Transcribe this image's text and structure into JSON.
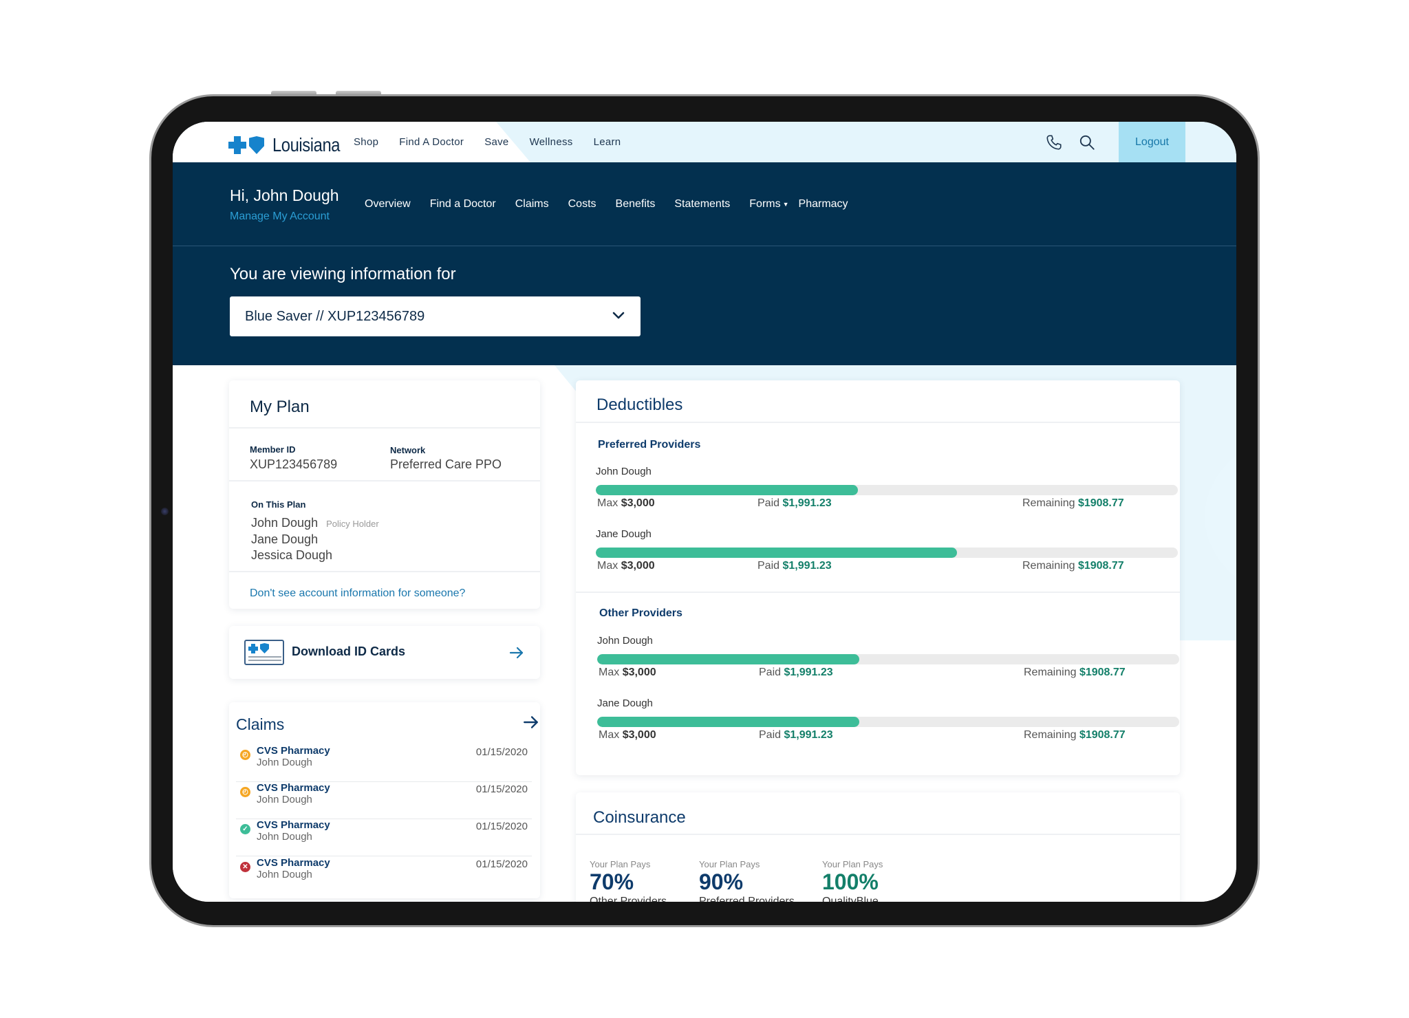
{
  "topbar": {
    "brand": "Louisiana",
    "nav": [
      "Shop",
      "Find A Doctor",
      "Save",
      "Wellness",
      "Learn"
    ],
    "icons": [
      "phone-icon",
      "search-icon"
    ],
    "logout": "Logout"
  },
  "header": {
    "greeting": "Hi, John Dough",
    "manage_account": "Manage My Account",
    "nav": [
      "Overview",
      "Find a Doctor",
      "Claims",
      "Costs",
      "Benefits",
      "Statements",
      "Forms",
      "Pharmacy"
    ],
    "viewing_label": "You are viewing information for",
    "plan_selected": "Blue Saver // XUP123456789"
  },
  "my_plan": {
    "title": "My Plan",
    "member_id_label": "Member ID",
    "member_id": "XUP123456789",
    "network_label": "Network",
    "network": "Preferred Care PPO",
    "on_plan_label": "On This Plan",
    "members": [
      {
        "name": "John Dough",
        "role": "Policy Holder"
      },
      {
        "name": "Jane Dough",
        "role": ""
      },
      {
        "name": "Jessica Dough",
        "role": ""
      }
    ],
    "missing_link": "Don't see account information for someone?"
  },
  "download": {
    "label": "Download ID Cards"
  },
  "claims": {
    "title": "Claims",
    "items": [
      {
        "provider": "CVS Pharmacy",
        "member": "John Dough",
        "date": "01/15/2020",
        "status": "pending"
      },
      {
        "provider": "CVS Pharmacy",
        "member": "John Dough",
        "date": "01/15/2020",
        "status": "pending"
      },
      {
        "provider": "CVS Pharmacy",
        "member": "John Dough",
        "date": "01/15/2020",
        "status": "approved"
      },
      {
        "provider": "CVS Pharmacy",
        "member": "John Dough",
        "date": "01/15/2020",
        "status": "denied"
      }
    ],
    "status_colors": {
      "pending": "#f5a623",
      "approved": "#3dbd98",
      "denied": "#c0313b"
    }
  },
  "deductibles": {
    "title": "Deductibles",
    "max_label": "Max",
    "paid_label": "Paid",
    "remaining_label": "Remaining",
    "groups": [
      {
        "title": "Preferred Providers",
        "people": [
          {
            "name": "John Dough",
            "max": "$3,000",
            "paid": "$1,991.23",
            "remaining": "$1908.77",
            "progress": 0.45
          },
          {
            "name": "Jane Dough",
            "max": "$3,000",
            "paid": "$1,991.23",
            "remaining": "$1908.77",
            "progress": 0.62
          }
        ]
      },
      {
        "title": "Other Providers",
        "people": [
          {
            "name": "John Dough",
            "max": "$3,000",
            "paid": "$1,991.23",
            "remaining": "$1908.77",
            "progress": 0.45
          },
          {
            "name": "Jane Dough",
            "max": "$3,000",
            "paid": "$1,991.23",
            "remaining": "$1908.77",
            "progress": 0.45
          }
        ]
      }
    ],
    "bar_color": "#3dbd98"
  },
  "coinsurance": {
    "title": "Coinsurance",
    "items": [
      {
        "label": "Your Plan Pays",
        "percent": "70%",
        "provider": "Other Providers"
      },
      {
        "label": "Your Plan Pays",
        "percent": "90%",
        "provider": "Preferred Providers"
      },
      {
        "label": "Your Plan Pays",
        "percent": "100%",
        "provider": "QualityBlue"
      }
    ]
  },
  "colors": {
    "header_bg": "#03304f",
    "accent": "#1a77ad",
    "green": "#137f69"
  }
}
